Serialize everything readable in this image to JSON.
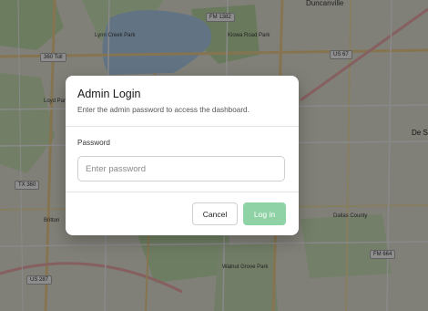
{
  "map": {
    "labels": {
      "fm1382": "FM 1382",
      "duncanville": "Duncanville",
      "lynn_creek": "Lynn Creek Park",
      "kiowa": "Kiowa Road Park",
      "toll360_top": "360 Toll",
      "us67": "US 67",
      "loyd_park": "Loyd Park",
      "de_soto": "De S",
      "tx360": "TX 360",
      "ellis_county": "Dallas County",
      "fm664": "FM 664",
      "us287": "US 287",
      "britton": "Britton",
      "walnut_grove": "Walnut Grove Park"
    }
  },
  "modal": {
    "title": "Admin Login",
    "description": "Enter the admin password to access the dashboard.",
    "password_label": "Password",
    "password_placeholder": "Enter password",
    "password_value": "",
    "cancel_label": "Cancel",
    "login_label": "Log in",
    "accent_color": "#8fd2a6"
  }
}
